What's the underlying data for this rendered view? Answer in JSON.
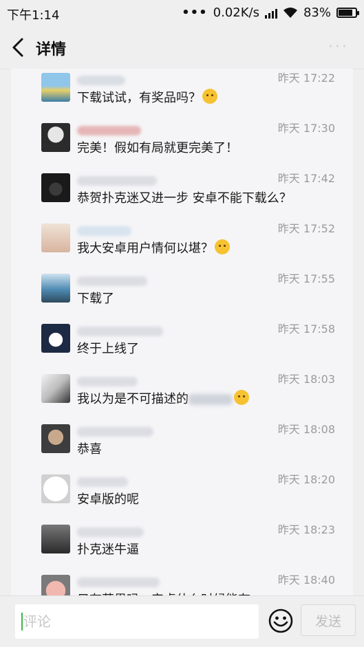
{
  "status_bar": {
    "time": "下午1:14",
    "signal_dots": "•••",
    "network_speed": "0.02K/s",
    "battery_percent": "83%",
    "battery_level": 0.83
  },
  "header": {
    "title": "详情",
    "more_label": "···"
  },
  "comments": [
    {
      "time": "昨天 17:22",
      "text": "下载试试，有奖品吗？",
      "emoji": true,
      "avatar": "landscape",
      "name_color": "#d9dde4"
    },
    {
      "time": "昨天 17:30",
      "text": "完美！假如有局就更完美了！",
      "emoji": false,
      "avatar": "bearded-man",
      "name_color": "#e6b6b6"
    },
    {
      "time": "昨天 17:42",
      "text": "恭贺扑克迷又进一步 安卓不能下载么？",
      "emoji": false,
      "avatar": "gorilla",
      "name_color": "#dcdde3"
    },
    {
      "time": "昨天 17:52",
      "text": "我大安卓用户情何以堪？",
      "emoji": true,
      "avatar": "girl",
      "name_color": "#d7e3ee"
    },
    {
      "time": "昨天 17:55",
      "text": "下载了",
      "emoji": false,
      "avatar": "sea",
      "name_color": "#dcdde3"
    },
    {
      "time": "昨天 17:58",
      "text": "终于上线了",
      "emoji": false,
      "avatar": "rabbit",
      "name_color": "#dcdde3"
    },
    {
      "time": "昨天 18:03",
      "text": "我以为是不可描述的",
      "emoji": true,
      "blurred_tail": true,
      "avatar": "sketch",
      "name_color": "#dcdde3"
    },
    {
      "time": "昨天 18:08",
      "text": "恭喜",
      "emoji": false,
      "avatar": "man-portrait",
      "name_color": "#dcdde3"
    },
    {
      "time": "昨天 18:20",
      "text": "安卓版的呢",
      "emoji": false,
      "avatar": "cartoon-face",
      "name_color": "#dcdde3"
    },
    {
      "time": "昨天 18:23",
      "text": "扑克迷牛逼",
      "emoji": false,
      "avatar": "man-dark",
      "name_color": "#dcdde3"
    },
    {
      "time": "昨天 18:40",
      "text": "只有苹果吗，安卓什么时候能有",
      "emoji": false,
      "avatar": "pig",
      "name_color": "#dcdde3"
    }
  ],
  "input_bar": {
    "placeholder": "评论",
    "send_label": "发送"
  },
  "icons": {
    "back": "chevron-left-icon",
    "more": "more-dots-icon",
    "emoji": "smiley-icon",
    "wifi": "wifi-icon",
    "battery": "battery-icon"
  }
}
